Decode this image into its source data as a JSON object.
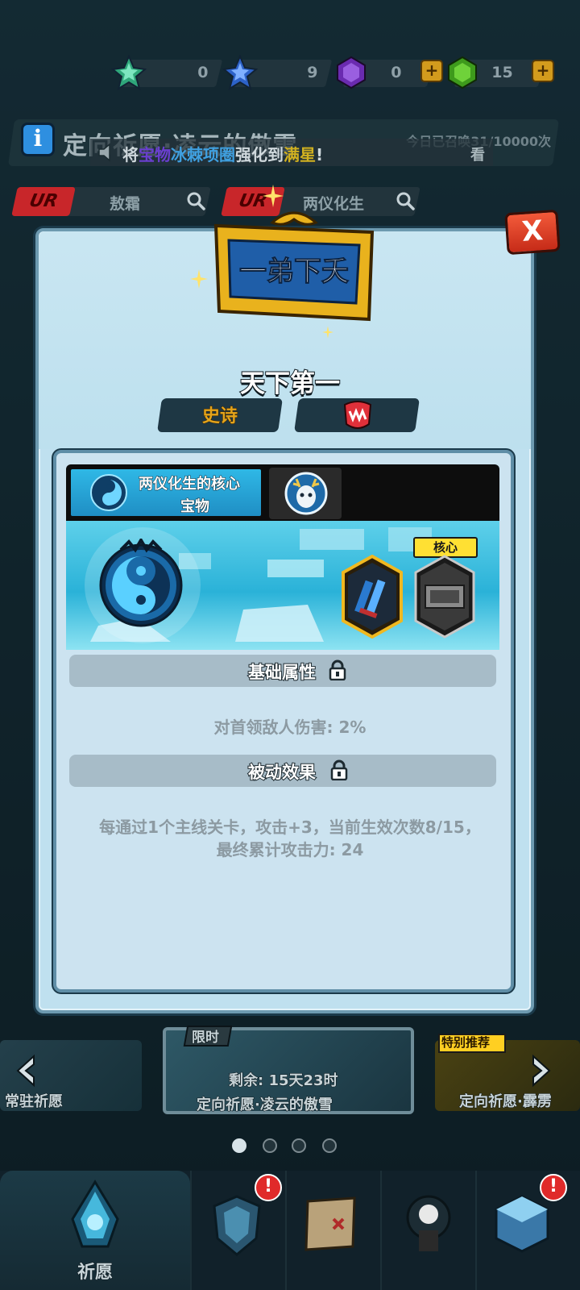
{
  "currencies": [
    {
      "icon": "green-star-icon",
      "value": "0"
    },
    {
      "icon": "blue-star-icon",
      "value": "9"
    },
    {
      "icon": "purple-gem-icon",
      "value": "0",
      "plus": "+"
    },
    {
      "icon": "green-gem-icon",
      "value": "15",
      "plus": "+"
    }
  ],
  "banner": {
    "info_icon": "i",
    "title": "定向祈愿·凌云的傲雪",
    "tip_pre": "将",
    "tip_hl1": "宝物",
    "tip_hl2": "冰棘项圈",
    "tip_mid": "强化到",
    "tip_hl3": "满星",
    "tip_end": "!",
    "today_count": "今日已召唤31/10000次",
    "look": "看"
  },
  "selectors": [
    {
      "tag": "UR",
      "name": "敖霜"
    },
    {
      "tag": "UR",
      "name": "两仪化生"
    }
  ],
  "modal": {
    "close_label": "X",
    "plaque_text": "一弟下夭",
    "item_name": "天下第一",
    "rarity": "史诗",
    "tabs": [
      {
        "title": "两仪化生的核心",
        "subtitle": "宝物",
        "icon": "yin-yang-icon"
      },
      {
        "icon": "deer-spirit-icon"
      }
    ],
    "core_label": "核心",
    "base_attr_title": "基础属性",
    "base_attr_value": "对首领敌人伤害: 2%",
    "passive_title": "被动效果",
    "passive_desc_line1": "每通过1个主线关卡，攻击+3，当前生效次数8/15，",
    "passive_desc_line2": "最终累计攻击力: 24"
  },
  "carousel": {
    "left_label": "常驻祈愿",
    "center_tag": "限时",
    "center_remaining": "剩余: 15天23时",
    "center_label": "定向祈愿·凌云的傲雪",
    "right_tag": "特别推荐",
    "right_label": "定向祈愿·霹雳",
    "dots": 4,
    "active_dot": 0
  },
  "nav": {
    "active_label": "祈愿",
    "badge": "!"
  },
  "colors": {
    "accent_gold": "#e3a41c",
    "close_red": "#d8391f",
    "panel_blue": "#cce3f0",
    "core_yellow": "#ffe033"
  }
}
